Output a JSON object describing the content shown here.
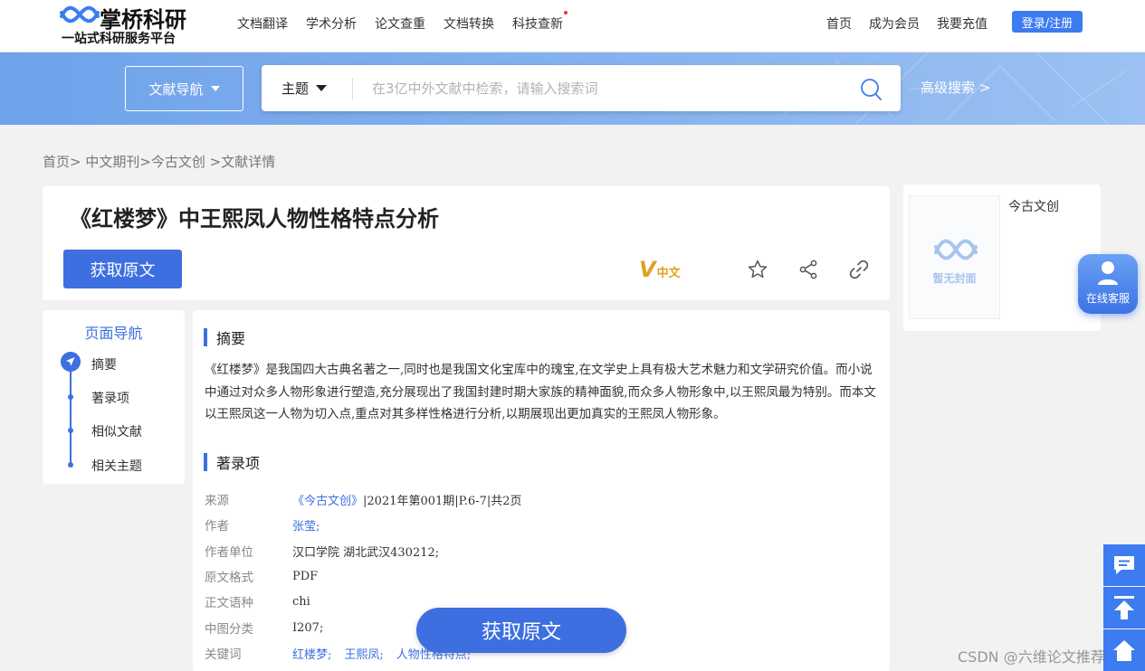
{
  "header": {
    "logo_name": "掌桥科研",
    "logo_slogan": "一站式科研服务平台",
    "nav_main": [
      {
        "label": "文档翻译"
      },
      {
        "label": "学术分析"
      },
      {
        "label": "论文查重"
      },
      {
        "label": "文档转换"
      },
      {
        "label": "科技查新"
      }
    ],
    "nav_right": [
      {
        "label": "首页"
      },
      {
        "label": "成为会员"
      },
      {
        "label": "我要充值"
      }
    ],
    "login_label": "登录/注册"
  },
  "search": {
    "doc_nav_label": "文献导航",
    "scope_label": "主题",
    "placeholder": "在3亿中外文献中检索，请输入搜索词",
    "advanced_label": "高级搜索 >"
  },
  "breadcrumb": "首页> 中文期刊>今古文创 >文献详情",
  "article": {
    "title": "《红楼梦》中王熙凤人物性格特点分析",
    "get_original_label": "获取原文",
    "badge_v": "V",
    "badge_lang": "中文"
  },
  "cover": {
    "placeholder_text": "暂无封面",
    "journal": "今古文创"
  },
  "online_service_label": "在线客服",
  "page_nav": {
    "title": "页面导航",
    "items": [
      {
        "label": "摘要"
      },
      {
        "label": "著录项"
      },
      {
        "label": "相似文献"
      },
      {
        "label": "相关主题"
      }
    ]
  },
  "content": {
    "abstract_title": "摘要",
    "abstract_text": "《红楼梦》是我国四大古典名著之一,同时也是我国文化宝库中的瑰宝,在文学史上具有极大艺术魅力和文学研究价值。而小说中通过对众多人物形象进行塑造,充分展现出了我国封建时期大家族的精神面貌,而众多人物形象中,以王熙凤最为特别。而本文以王熙凤这一人物为切入点,重点对其多样性格进行分析,以期展现出更加真实的王熙凤人物形象。",
    "catalog_title": "著录项",
    "meta": {
      "source_label": "来源",
      "source_link": "《今古文创》",
      "source_detail": "|2021年第001期|P.6-7|共2页",
      "author_label": "作者",
      "author_value": "张莹;",
      "affiliation_label": "作者单位",
      "affiliation_value": "汉口学院 湖北武汉430212;",
      "format_label": "原文格式",
      "format_value": "PDF",
      "language_label": "正文语种",
      "language_value": "chi",
      "clc_label": "中图分类",
      "clc_value": "I207;",
      "keywords_label": "关键词",
      "keywords": [
        "红楼梦;",
        "王熙凤;",
        "人物性格特点;"
      ]
    }
  },
  "float_get_label": "获取原文",
  "watermark": "CSDN @六维论文推荐",
  "colors": {
    "primary": "#3d6fe0",
    "accent": "#3d7bf0",
    "band": "#7fadec"
  }
}
